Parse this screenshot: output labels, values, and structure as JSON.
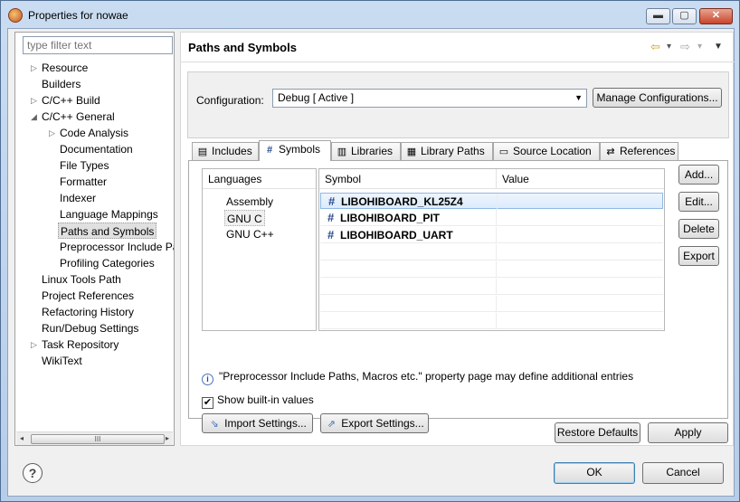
{
  "window": {
    "title": "Properties for nowae",
    "min_glyph": "▬",
    "max_glyph": "▢",
    "close_glyph": "✕"
  },
  "filter": {
    "placeholder": "type filter text"
  },
  "tree": [
    {
      "label": "Resource",
      "expander": "▷"
    },
    {
      "label": "Builders",
      "expander": ""
    },
    {
      "label": "C/C++ Build",
      "expander": "▷"
    },
    {
      "label": "C/C++ General",
      "expander": "◢"
    },
    {
      "label": "Code Analysis",
      "expander": "▷"
    },
    {
      "label": "Documentation",
      "expander": ""
    },
    {
      "label": "File Types",
      "expander": ""
    },
    {
      "label": "Formatter",
      "expander": ""
    },
    {
      "label": "Indexer",
      "expander": ""
    },
    {
      "label": "Language Mappings",
      "expander": ""
    },
    {
      "label": "Paths and Symbols",
      "expander": "",
      "selected": true
    },
    {
      "label": "Preprocessor Include Pa",
      "expander": ""
    },
    {
      "label": "Profiling Categories",
      "expander": ""
    },
    {
      "label": "Linux Tools Path",
      "expander": ""
    },
    {
      "label": "Project References",
      "expander": ""
    },
    {
      "label": "Refactoring History",
      "expander": ""
    },
    {
      "label": "Run/Debug Settings",
      "expander": ""
    },
    {
      "label": "Task Repository",
      "expander": "▷"
    },
    {
      "label": "WikiText",
      "expander": ""
    }
  ],
  "scroll": {
    "left": "◂",
    "right": "▸",
    "thumb": "III"
  },
  "page": {
    "title": "Paths and Symbols",
    "nav_icons": {
      "back": "⇦",
      "back_menu": "▾",
      "forward": "⇨",
      "forward_menu": "▾",
      "view_menu": "▼"
    }
  },
  "configuration": {
    "label": "Configuration:",
    "value": "Debug  [ Active ]",
    "caret": "▼",
    "manage_button": "Manage Configurations..."
  },
  "tabs": [
    {
      "label": "Includes",
      "icon": "▤"
    },
    {
      "label": "Symbols",
      "icon": "#",
      "active": true
    },
    {
      "label": "Libraries",
      "icon": "▥"
    },
    {
      "label": "Library Paths",
      "icon": "▦"
    },
    {
      "label": "Source Location",
      "icon": "▭"
    },
    {
      "label": "References",
      "icon": "⇄"
    }
  ],
  "languages": {
    "header": "Languages",
    "items": [
      "Assembly",
      "GNU C",
      "GNU C++"
    ],
    "selected_index": 1
  },
  "symbols": {
    "columns": [
      "Symbol",
      "Value"
    ],
    "icon": "#",
    "rows": [
      {
        "symbol": "LIBOHIBOARD_KL25Z4",
        "value": ""
      },
      {
        "symbol": "LIBOHIBOARD_PIT",
        "value": ""
      },
      {
        "symbol": "LIBOHIBOARD_UART",
        "value": ""
      }
    ]
  },
  "side_buttons": [
    "Add...",
    "Edit...",
    "Delete",
    "Export"
  ],
  "info": {
    "icon": "i",
    "text": "\"Preprocessor Include Paths, Macros etc.\" property page may define additional entries"
  },
  "show_builtin": {
    "label": "Show built-in values",
    "checked": true,
    "mark": "✔"
  },
  "import_button": "Import Settings...",
  "export_button": "Export Settings...",
  "import_icon": "⇘",
  "export_icon": "⇗",
  "restore_defaults": "Restore Defaults",
  "apply": "Apply",
  "help_glyph": "?",
  "ok": "OK",
  "cancel": "Cancel"
}
